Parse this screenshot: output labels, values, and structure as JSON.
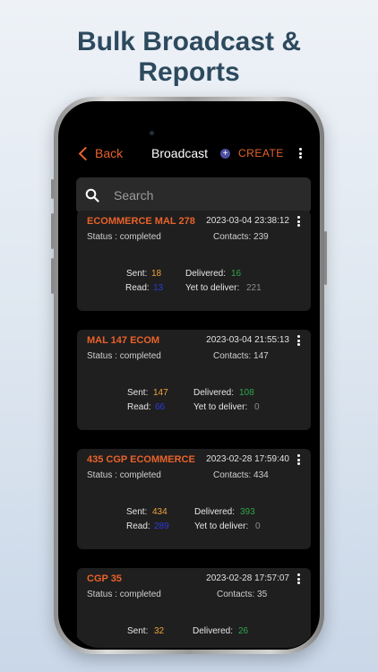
{
  "headline": {
    "line1": "Bulk Broadcast &",
    "line2": "Reports"
  },
  "navbar": {
    "back_label": "Back",
    "title": "Broadcast",
    "create_label": "CREATE"
  },
  "search": {
    "placeholder": "Search"
  },
  "labels": {
    "status": "Status :",
    "contacts": "Contacts:",
    "sent": "Sent:",
    "read": "Read:",
    "delivered": "Delivered:",
    "yet_to_deliver": "Yet to deliver:"
  },
  "broadcasts": [
    {
      "name": "ECOMMERCE MAL 278",
      "datetime": "2023-03-04 23:38:12",
      "status": "completed",
      "contacts": "239",
      "sent": "18",
      "read": "13",
      "delivered": "16",
      "yet_to_deliver": "221"
    },
    {
      "name": "MAL 147 ECOM",
      "datetime": "2023-03-04 21:55:13",
      "status": "completed",
      "contacts": "147",
      "sent": "147",
      "read": "66",
      "delivered": "108",
      "yet_to_deliver": "0"
    },
    {
      "name": "435 CGP ECOMMERCE",
      "datetime": "2023-02-28 17:59:40",
      "status": "completed",
      "contacts": "434",
      "sent": "434",
      "read": "289",
      "delivered": "393",
      "yet_to_deliver": "0"
    },
    {
      "name": "CGP 35",
      "datetime": "2023-02-28 17:57:07",
      "status": "completed",
      "contacts": "35",
      "sent": "32",
      "read": "",
      "delivered": "26",
      "yet_to_deliver": ""
    }
  ],
  "colors": {
    "accent": "#e8622a",
    "sent": "#f0a23a",
    "delivered": "#2fa64a",
    "read": "#2f3bd8",
    "pending": "#8c8c8c"
  }
}
